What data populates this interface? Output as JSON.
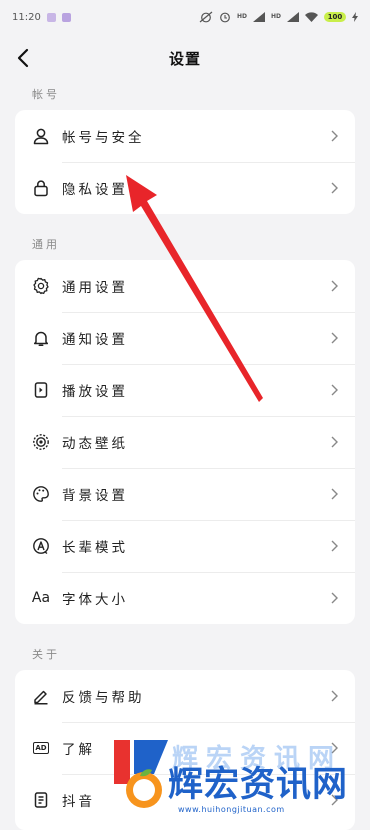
{
  "status_bar": {
    "time": "11:20",
    "network_badges": [
      "HD",
      "HD"
    ],
    "battery": "100"
  },
  "header": {
    "title": "设置"
  },
  "sections": [
    {
      "label": "帐号",
      "items": [
        {
          "label": "帐号与安全",
          "icon": "user-icon"
        },
        {
          "label": "隐私设置",
          "icon": "lock-icon"
        }
      ]
    },
    {
      "label": "通用",
      "items": [
        {
          "label": "通用设置",
          "icon": "gear-icon"
        },
        {
          "label": "通知设置",
          "icon": "bell-icon"
        },
        {
          "label": "播放设置",
          "icon": "play-settings-icon"
        },
        {
          "label": "动态壁纸",
          "icon": "live-wallpaper-icon"
        },
        {
          "label": "背景设置",
          "icon": "palette-icon"
        },
        {
          "label": "长辈模式",
          "icon": "elder-mode-icon"
        },
        {
          "label": "字体大小",
          "icon": "font-size-icon",
          "icon_text": "Aa"
        }
      ]
    },
    {
      "label": "关于",
      "items": [
        {
          "label": "反馈与帮助",
          "icon": "edit-icon"
        },
        {
          "label": "了解",
          "icon": "ad-icon",
          "icon_text": "AD"
        },
        {
          "label": "抖音",
          "icon": "document-icon"
        }
      ]
    }
  ],
  "watermark": {
    "text": "辉宏资讯网",
    "url": "www.huihongjituan.com",
    "colors": {
      "blue": "#1f62c9",
      "red": "#e8322f",
      "orange": "#f7941d",
      "green": "#6cb33f"
    }
  },
  "annotation": {
    "color": "#e8252a",
    "target": "privacy-settings-row"
  }
}
